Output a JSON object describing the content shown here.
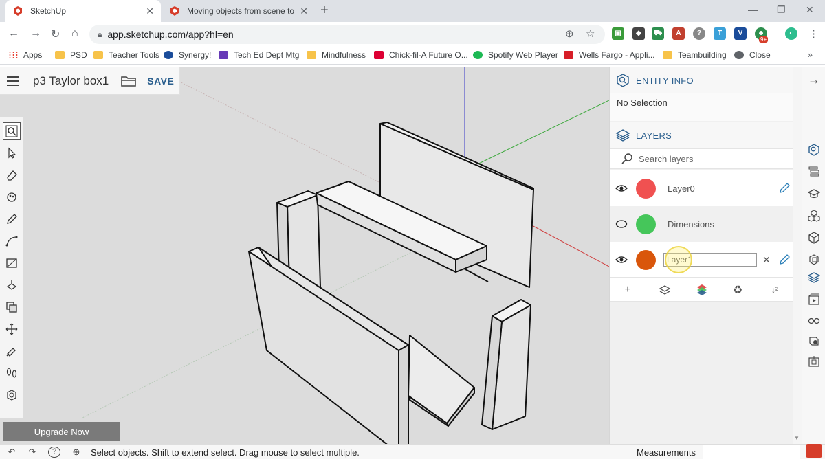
{
  "browser": {
    "tabs": [
      {
        "title": "SketchUp",
        "active": true
      },
      {
        "title": "Moving objects from scene to sc",
        "active": false
      }
    ],
    "url": "app.sketchup.com/app?hl=en",
    "bookmarks": [
      {
        "label": "Apps",
        "icon": "apps-grid-icon",
        "color": "#e94235"
      },
      {
        "label": "PSD",
        "icon": "folder-icon",
        "color": "#f7c34a"
      },
      {
        "label": "Teacher Tools",
        "icon": "folder-icon",
        "color": "#f7c34a"
      },
      {
        "label": "Synergy!",
        "icon": "synergy-icon",
        "color": "#1a4c9a"
      },
      {
        "label": "Tech Ed Dept Mtg",
        "icon": "forms-icon",
        "color": "#673ab7"
      },
      {
        "label": "Mindfulness",
        "icon": "folder-icon",
        "color": "#f7c34a"
      },
      {
        "label": "Chick-fil-A Future O...",
        "icon": "cfa-icon",
        "color": "#dd0033"
      },
      {
        "label": "Spotify Web Player",
        "icon": "spotify-icon",
        "color": "#1db954"
      },
      {
        "label": "Wells Fargo - Appli...",
        "icon": "wf-icon",
        "color": "#d71e28"
      },
      {
        "label": "Teambuilding",
        "icon": "folder-icon",
        "color": "#f7c34a"
      },
      {
        "label": "Close",
        "icon": "globe-icon",
        "color": "#5f6368"
      }
    ],
    "ext_badge": "9+"
  },
  "app": {
    "model_title": "p3 Taylor box1",
    "save_label": "SAVE",
    "upgrade_label": "Upgrade Now",
    "status_text": "Select objects. Shift to extend select. Drag mouse to select multiple.",
    "measurements_label": "Measurements"
  },
  "panel": {
    "entity_info": {
      "title": "ENTITY INFO",
      "selection": "No Selection"
    },
    "layers": {
      "title": "LAYERS",
      "search_placeholder": "Search layers",
      "items": [
        {
          "name": "Layer0",
          "color": "#f05151",
          "visible": true
        },
        {
          "name": "Dimensions",
          "color": "#45c65a",
          "visible": false
        },
        {
          "name": "Layer1",
          "color": "#d9560b",
          "visible": true,
          "editing": true
        }
      ]
    }
  },
  "colors": {
    "accent": "#2b5f8e",
    "viewport": "#dcdcdc",
    "axis_red": "#d04040",
    "axis_green": "#3ca83c",
    "axis_blue": "#3a3ac8"
  }
}
